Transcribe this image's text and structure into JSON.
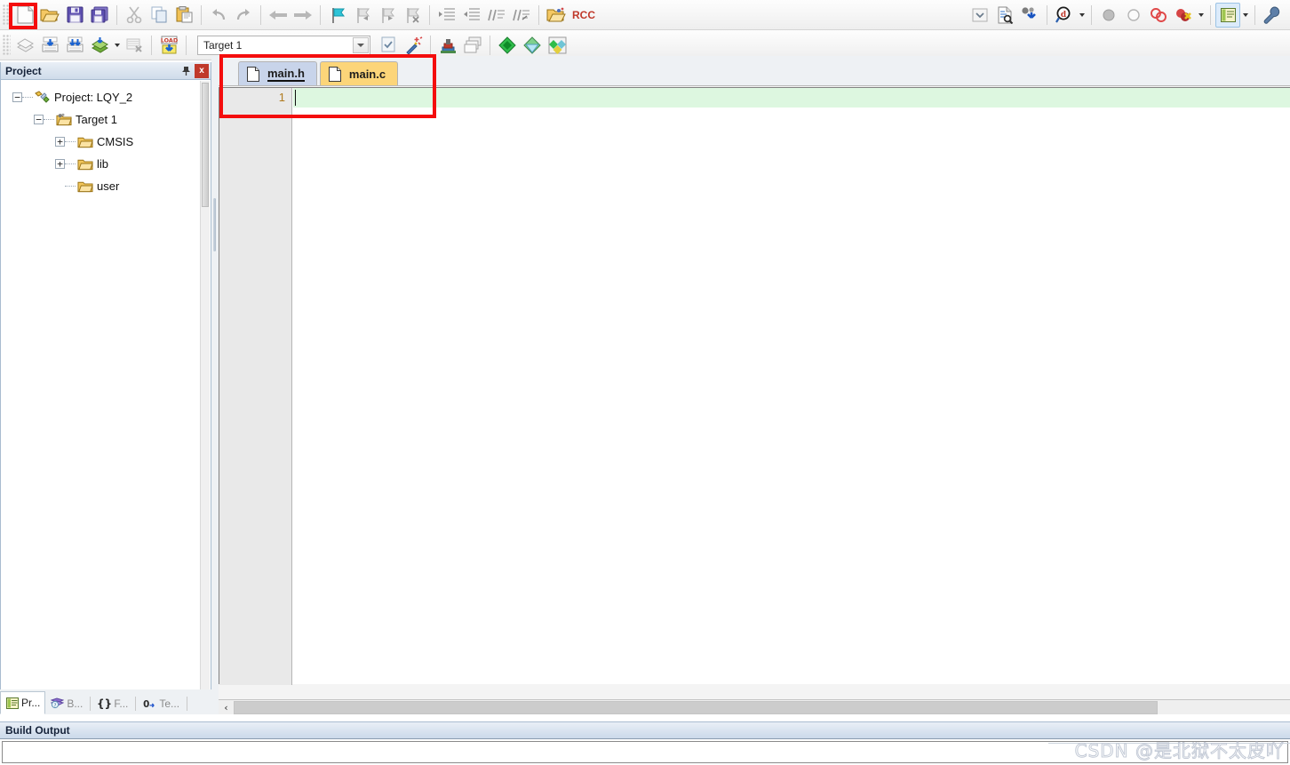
{
  "app": {
    "title": "Keil uVision IDE"
  },
  "toolbar_main": {
    "groups": [
      {
        "items": [
          {
            "name": "new-file-button",
            "icon": "new-file-icon",
            "tooltip": "New",
            "selected": false
          },
          {
            "name": "open-file-button",
            "icon": "open-folder-icon",
            "tooltip": "Open",
            "selected": false
          },
          {
            "name": "save-button",
            "icon": "save-floppy-icon",
            "tooltip": "Save",
            "selected": false
          },
          {
            "name": "save-all-button",
            "icon": "save-all-icon",
            "tooltip": "Save All",
            "selected": false
          }
        ]
      },
      {
        "items": [
          {
            "name": "cut-button",
            "icon": "scissors-icon",
            "tooltip": "Cut",
            "selected": false
          },
          {
            "name": "copy-button",
            "icon": "copy-icon",
            "tooltip": "Copy",
            "selected": false
          },
          {
            "name": "paste-button",
            "icon": "paste-icon",
            "tooltip": "Paste",
            "selected": false
          }
        ]
      },
      {
        "items": [
          {
            "name": "undo-button",
            "icon": "undo-arrow-icon",
            "tooltip": "Undo",
            "selected": false
          },
          {
            "name": "redo-button",
            "icon": "redo-arrow-icon",
            "tooltip": "Redo",
            "selected": false
          }
        ]
      },
      {
        "items": [
          {
            "name": "navigate-back-button",
            "icon": "arrow-left-icon",
            "tooltip": "Back",
            "selected": false
          },
          {
            "name": "navigate-forward-button",
            "icon": "arrow-right-icon",
            "tooltip": "Forward",
            "selected": false
          }
        ]
      },
      {
        "items": [
          {
            "name": "toggle-bookmark-button",
            "icon": "bookmark-flag-icon",
            "tooltip": "Insert/Remove Bookmark",
            "selected": false
          },
          {
            "name": "prev-bookmark-button",
            "icon": "bookmark-prev-icon",
            "tooltip": "Previous Bookmark",
            "selected": false
          },
          {
            "name": "next-bookmark-button",
            "icon": "bookmark-next-icon",
            "tooltip": "Next Bookmark",
            "selected": false
          },
          {
            "name": "clear-bookmarks-button",
            "icon": "bookmark-clear-icon",
            "tooltip": "Clear All Bookmarks",
            "selected": false
          }
        ]
      },
      {
        "items": [
          {
            "name": "indent-button",
            "icon": "indent-right-icon",
            "tooltip": "Indent",
            "selected": false
          },
          {
            "name": "outdent-button",
            "icon": "indent-left-icon",
            "tooltip": "Outdent",
            "selected": false
          },
          {
            "name": "comment-button",
            "icon": "comment-lines-icon",
            "tooltip": "Comment",
            "selected": false
          },
          {
            "name": "uncomment-button",
            "icon": "uncomment-lines-icon",
            "tooltip": "Uncomment",
            "selected": false
          }
        ]
      },
      {
        "items": [
          {
            "name": "configuration-wizard-button",
            "icon": "folder-wizard-icon",
            "tooltip": "Configuration Wizard",
            "selected": false
          }
        ]
      }
    ],
    "rcc_label": "RCC",
    "right_items": [
      {
        "name": "browse-dropdown-button",
        "icon": "chevron-down-box-icon",
        "selected": false
      },
      {
        "name": "find-in-files-button",
        "icon": "document-search-icon",
        "selected": false
      },
      {
        "name": "download-target-button",
        "icon": "download-blue-arrow-icon",
        "selected": false
      },
      {
        "name": "debug-search-button",
        "icon": "magnifier-d-icon",
        "selected": false,
        "has_caret": true
      },
      {
        "name": "breakpoint-gray-button",
        "icon": "circle-gray-icon",
        "selected": false
      },
      {
        "name": "breakpoint-hollow-button",
        "icon": "circle-hollow-icon",
        "selected": false
      },
      {
        "name": "breakpoint-disable-button",
        "icon": "rings-red-icon",
        "selected": false
      },
      {
        "name": "kill-breakpoints-button",
        "icon": "breakpoint-delete-icon",
        "selected": false,
        "has_caret": true
      },
      {
        "name": "window-layout-button",
        "icon": "window-panel-icon",
        "selected": true,
        "has_caret": true
      },
      {
        "name": "configure-tools-button",
        "icon": "wrench-icon",
        "selected": false
      }
    ]
  },
  "toolbar_build": {
    "left_items": [
      {
        "name": "translate-file-button",
        "icon": "translate-layers-icon"
      },
      {
        "name": "build-target-button",
        "icon": "build-icon"
      },
      {
        "name": "rebuild-all-button",
        "icon": "rebuild-all-icon"
      },
      {
        "name": "batch-build-button",
        "icon": "batch-build-icon",
        "has_caret": true
      },
      {
        "name": "stop-build-button",
        "icon": "stop-build-icon"
      },
      {
        "name": "download-load-button",
        "icon": "load-download-icon"
      }
    ],
    "target_select": {
      "value": "Target 1",
      "name": "target-select"
    },
    "right_items": [
      {
        "name": "target-options-button",
        "icon": "target-options-icon"
      },
      {
        "name": "manage-runtime-button",
        "icon": "magic-wand-icon"
      },
      {
        "name": "manage-project-items-button",
        "icon": "project-items-icon"
      },
      {
        "name": "manage-multi-project-button",
        "icon": "multi-project-icon"
      },
      {
        "name": "components-button",
        "icon": "green-diamond-icon"
      },
      {
        "name": "pack-installer-button",
        "icon": "pack-installer-icon"
      },
      {
        "name": "pack-manager-button",
        "icon": "pack-manager-icon"
      }
    ]
  },
  "project_panel": {
    "title": "Project",
    "pin_label": "pin",
    "close_label": "x",
    "tree": [
      {
        "name": "tree-item-project",
        "label": "Project: LQY_2",
        "depth": 0,
        "expander": "minus",
        "icon": "project-icon"
      },
      {
        "name": "tree-item-target",
        "label": "Target 1",
        "depth": 1,
        "expander": "minus",
        "icon": "target-folder-icon"
      },
      {
        "name": "tree-item-cmsis",
        "label": "CMSIS",
        "depth": 2,
        "expander": "plus",
        "icon": "folder-icon"
      },
      {
        "name": "tree-item-lib",
        "label": "lib",
        "depth": 2,
        "expander": "plus",
        "icon": "folder-icon"
      },
      {
        "name": "tree-item-user",
        "label": "user",
        "depth": 2,
        "expander": "none",
        "icon": "folder-icon"
      }
    ]
  },
  "side_tabs": [
    {
      "name": "sidebar-tab-project",
      "label": "Pr...",
      "icon": "project-panel-icon",
      "active": true
    },
    {
      "name": "sidebar-tab-books",
      "label": "B...",
      "icon": "books-icon",
      "active": false
    },
    {
      "name": "sidebar-tab-functions",
      "label": "F...",
      "icon": "braces-icon",
      "active": false
    },
    {
      "name": "sidebar-tab-templates",
      "label": "Te...",
      "icon": "templates-icon",
      "active": false
    }
  ],
  "editor": {
    "tabs": [
      {
        "name": "editor-tab-main-h",
        "label": "main.h",
        "active": true,
        "icon": "file-icon"
      },
      {
        "name": "editor-tab-main-c",
        "label": "main.c",
        "active": false,
        "icon": "file-icon"
      }
    ],
    "line_numbers": [
      "1"
    ],
    "lines": [
      ""
    ],
    "scroll_left_arrow": "‹"
  },
  "build_output": {
    "title": "Build Output",
    "content": ""
  },
  "watermark": {
    "text": "CSDN @是北狱不太皮吖"
  },
  "colors": {
    "annotation_red": "#f40d0d",
    "current_line_green": "#ddf7e0",
    "tab_active_blue": "#c8d4ea",
    "tab_inactive_orange": "#fcd579",
    "panel_header_blue": "#cfdcea",
    "rcc_label_red": "#c0392b"
  }
}
